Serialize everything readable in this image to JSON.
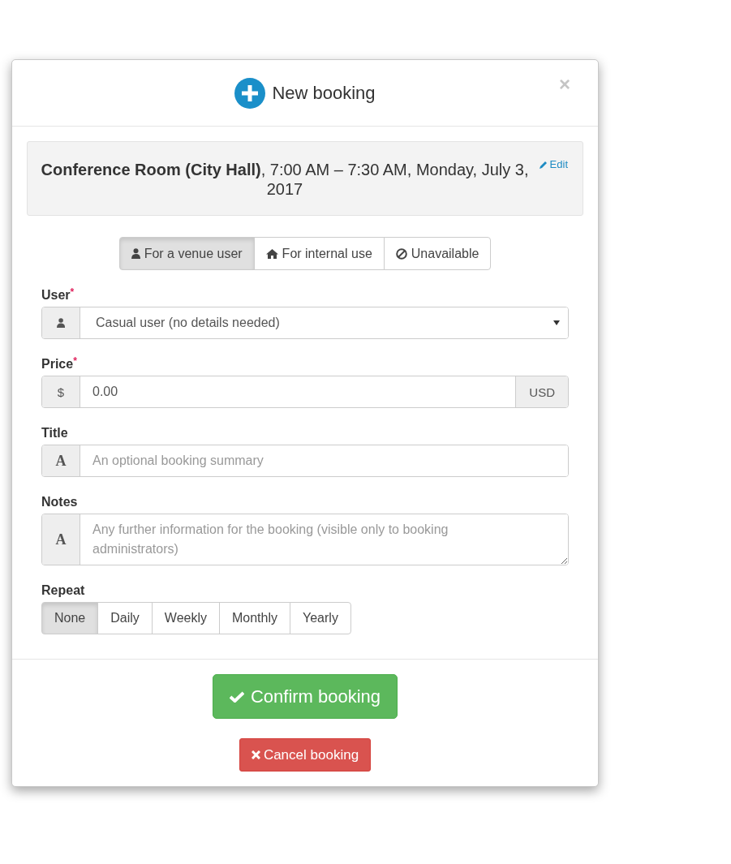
{
  "dialog": {
    "title": "New booking",
    "close": "×"
  },
  "summary": {
    "text": "**Conference Room (City Hall)**, 7:00 AM – 7:30 AM, Monday, July 3, 2017",
    "edit": "Edit"
  },
  "booking_types": [
    {
      "label": "For a venue user",
      "selected": true
    },
    {
      "label": "For internal use",
      "selected": false
    },
    {
      "label": "Unavailable",
      "selected": false
    }
  ],
  "fields": [
    {
      "kind": "select",
      "label": "User",
      "required_mark": "*",
      "value": "Casual user (no details needed)"
    },
    {
      "kind": "input",
      "label": "Price",
      "required_mark": "*",
      "addon_text": "$",
      "value": "0.00",
      "suffix": "USD"
    },
    {
      "kind": "input",
      "label": "Title",
      "addon_text": "A",
      "placeholder": "An optional booking summary"
    },
    {
      "kind": "textarea",
      "label": "Notes",
      "addon_text": "A",
      "placeholder": "Any further information for the booking (visible only to booking administrators)"
    }
  ],
  "repeat": {
    "label": "Repeat",
    "options": [
      {
        "label": "None",
        "selected": true
      },
      {
        "label": "Daily",
        "selected": false
      },
      {
        "label": "Weekly",
        "selected": false
      },
      {
        "label": "Monthly",
        "selected": false
      },
      {
        "label": "Yearly",
        "selected": false
      }
    ]
  },
  "confirm_button": "Confirm booking",
  "cancel_button": "Cancel booking"
}
